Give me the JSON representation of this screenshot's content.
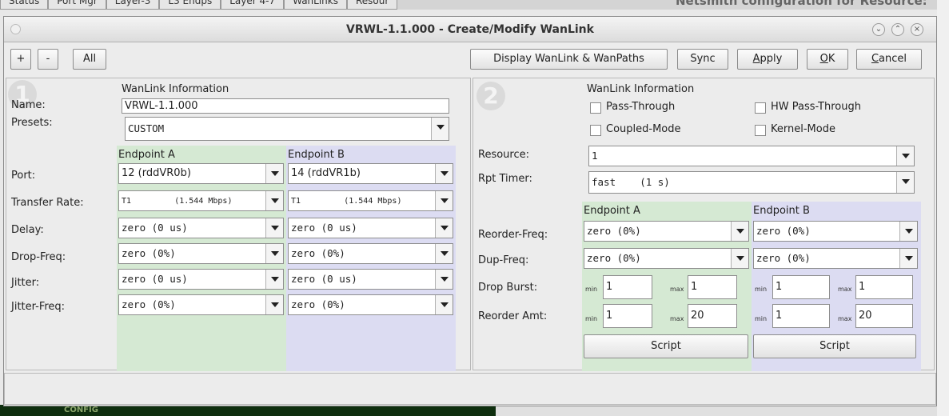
{
  "background": {
    "tabs": [
      "Status",
      "Port Mgr",
      "Layer-3",
      "L3 Endps",
      "Layer 4-7",
      "WanLinks",
      "Resour"
    ],
    "right_title": "Netsmith configuration for Resource:",
    "bottom_label": "CONFIG"
  },
  "window": {
    "title": "VRWL-1.1.000 - Create/Modify WanLink",
    "controls": [
      "⌄",
      "⌃",
      "×"
    ]
  },
  "toolbar": {
    "plus": "+",
    "minus": "-",
    "all": "All",
    "display": "Display WanLink & WanPaths",
    "sync": "Sync",
    "apply_pre": "",
    "apply_u": "A",
    "apply_post": "pply",
    "ok_pre": "",
    "ok_u": "O",
    "ok_post": "K",
    "cancel_pre": "",
    "cancel_u": "C",
    "cancel_post": "ancel"
  },
  "left": {
    "badge": "1",
    "section": "WanLink Information",
    "name_label": "Name:",
    "name_value": "VRWL-1.1.000",
    "presets_label": "Presets:",
    "presets_value": "CUSTOM",
    "ep_a": "Endpoint A",
    "ep_b": "Endpoint B",
    "rows": [
      {
        "label": "Port:",
        "a": "12 (rddVR0b)",
        "b": "14 (rddVR1b)"
      },
      {
        "label": "Transfer Rate:",
        "a": "T1         (1.544 Mbps)",
        "b": "T1         (1.544 Mbps)"
      },
      {
        "label": "Delay:",
        "a": "zero (0 us)",
        "b": "zero (0 us)"
      },
      {
        "label": "Drop-Freq:",
        "a": "zero (0%)",
        "b": "zero (0%)"
      },
      {
        "label": "Jitter:",
        "a": "zero (0 us)",
        "b": "zero (0 us)"
      },
      {
        "label": "Jitter-Freq:",
        "a": "zero (0%)",
        "b": "zero (0%)"
      }
    ]
  },
  "right": {
    "badge": "2",
    "section": "WanLink Information",
    "pass_through": "Pass-Through",
    "hw_pass_through": "HW Pass-Through",
    "coupled_mode": "Coupled-Mode",
    "kernel_mode": "Kernel-Mode",
    "resource_label": "Resource:",
    "resource_value": "1",
    "rpt_label": "Rpt Timer:",
    "rpt_value": "fast    (1 s)",
    "ep_a": "Endpoint A",
    "ep_b": "Endpoint B",
    "reorder_label": "Reorder-Freq:",
    "reorder_a": "zero (0%)",
    "reorder_b": "zero (0%)",
    "dup_label": "Dup-Freq:",
    "dup_a": "zero (0%)",
    "dup_b": "zero (0%)",
    "drop_burst_label": "Drop Burst:",
    "reorder_amt_label": "Reorder Amt:",
    "min": "min",
    "max": "max",
    "drop_burst": {
      "a_min": "1",
      "a_max": "1",
      "b_min": "1",
      "b_max": "1"
    },
    "reorder_amt": {
      "a_min": "1",
      "a_max": "20",
      "b_min": "1",
      "b_max": "20"
    },
    "script": "Script"
  },
  "colors": {
    "endpoint_a_bg": "#d5e9d3",
    "endpoint_b_bg": "#dcdcf2"
  }
}
